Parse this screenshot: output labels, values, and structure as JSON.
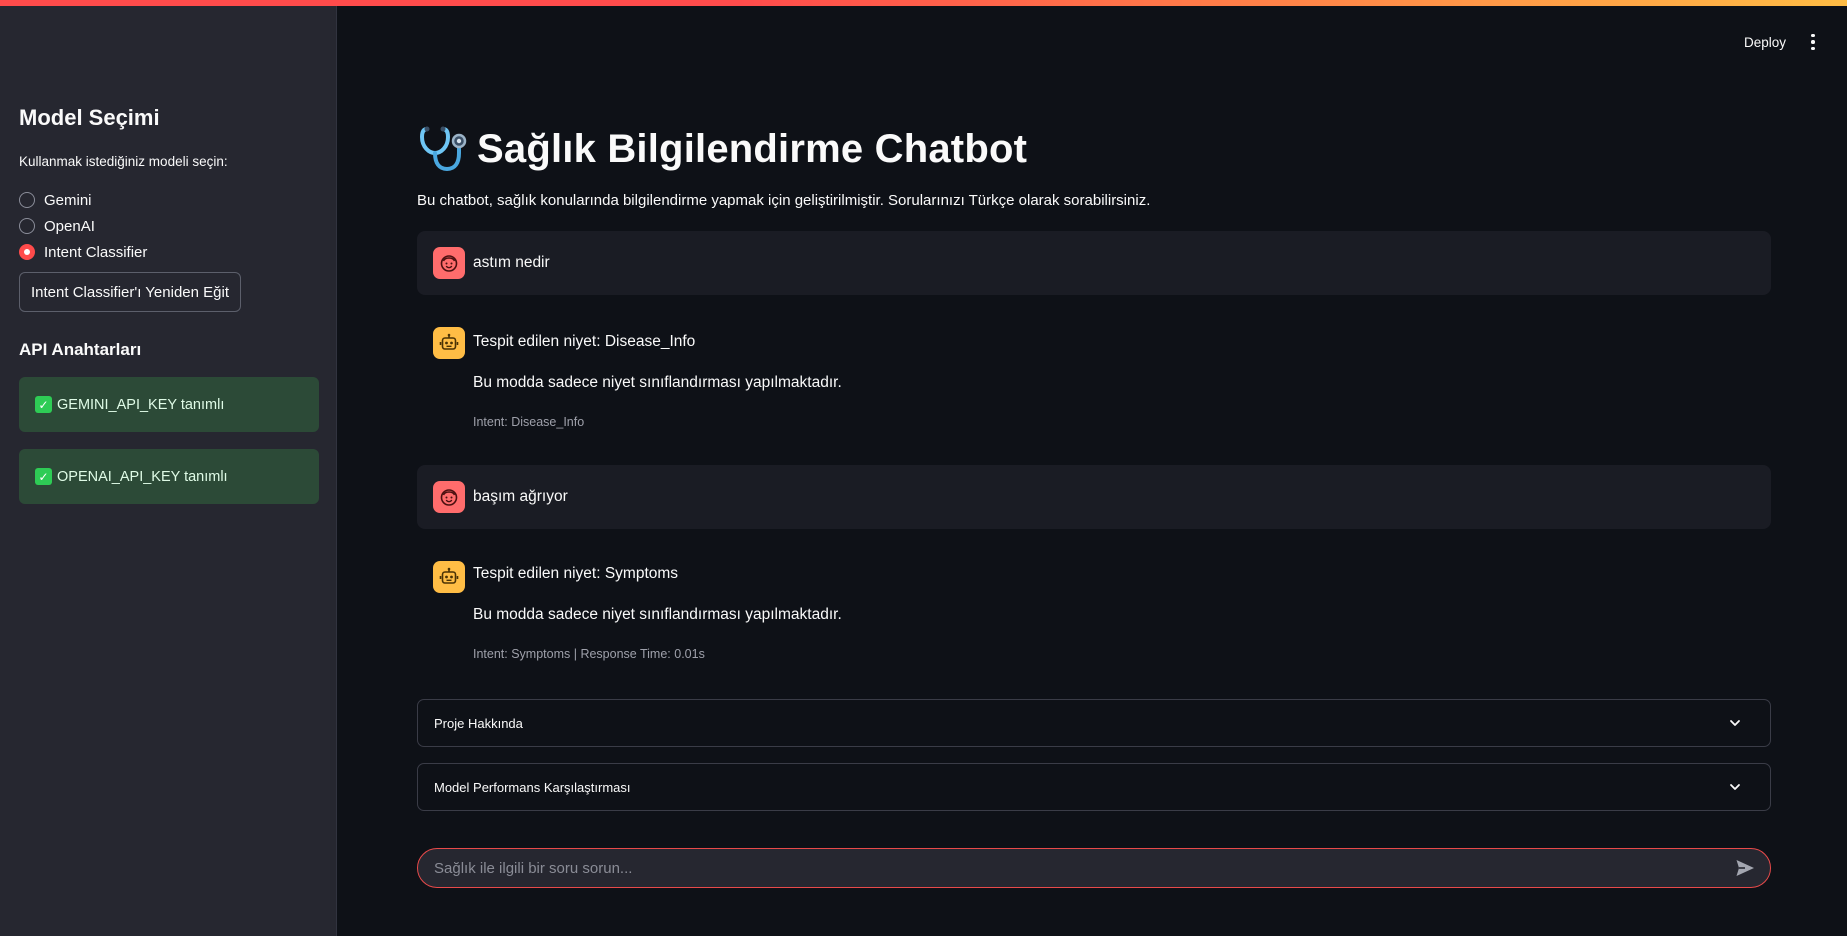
{
  "header": {
    "deploy_label": "Deploy"
  },
  "sidebar": {
    "title": "Model Seçimi",
    "radio_label": "Kullanmak istediğiniz modeli seçin:",
    "options": [
      {
        "label": "Gemini",
        "selected": false
      },
      {
        "label": "OpenAI",
        "selected": false
      },
      {
        "label": "Intent Classifier",
        "selected": true
      }
    ],
    "retrain_button": "Intent Classifier'ı Yeniden Eğit",
    "api_title": "API Anahtarları",
    "api_status": [
      "GEMINI_API_KEY tanımlı",
      "OPENAI_API_KEY tanımlı"
    ]
  },
  "main": {
    "title": "Sağlık Bilgilendirme Chatbot",
    "subtitle": "Bu chatbot, sağlık konularında bilgilendirme yapmak için geliştirilmiştir. Sorularınızı Türkçe olarak sorabilirsiniz.",
    "messages": [
      {
        "role": "user",
        "text": "astım nedir"
      },
      {
        "role": "assistant",
        "heading": "Tespit edilen niyet: Disease_Info",
        "body": "Bu modda sadece niyet sınıflandırması yapılmaktadır.",
        "caption": "Intent: Disease_Info"
      },
      {
        "role": "user",
        "text": "başım ağrıyor"
      },
      {
        "role": "assistant",
        "heading": "Tespit edilen niyet: Symptoms",
        "body": "Bu modda sadece niyet sınıflandırması yapılmaktadır.",
        "caption": "Intent: Symptoms | Response Time: 0.01s"
      }
    ],
    "expanders": [
      "Proje Hakkında",
      "Model Performans Karşılaştırması"
    ],
    "chat_input": {
      "placeholder": "Sağlık ile ilgili bir soru sorun...",
      "value": ""
    }
  },
  "colors": {
    "accent": "#ff4b4b",
    "background": "#0e1117",
    "sidebar": "#262730",
    "success_bg": "#2c4a37",
    "user_avatar": "#ff6c6c",
    "bot_avatar": "#ffbd45"
  },
  "icons": {
    "title_icon": "stethoscope-icon",
    "user_avatar": "face-icon",
    "bot_avatar": "robot-icon",
    "expander": "chevron-down-icon",
    "send": "send-icon",
    "menu": "kebab-menu-icon",
    "status": "check-icon"
  }
}
